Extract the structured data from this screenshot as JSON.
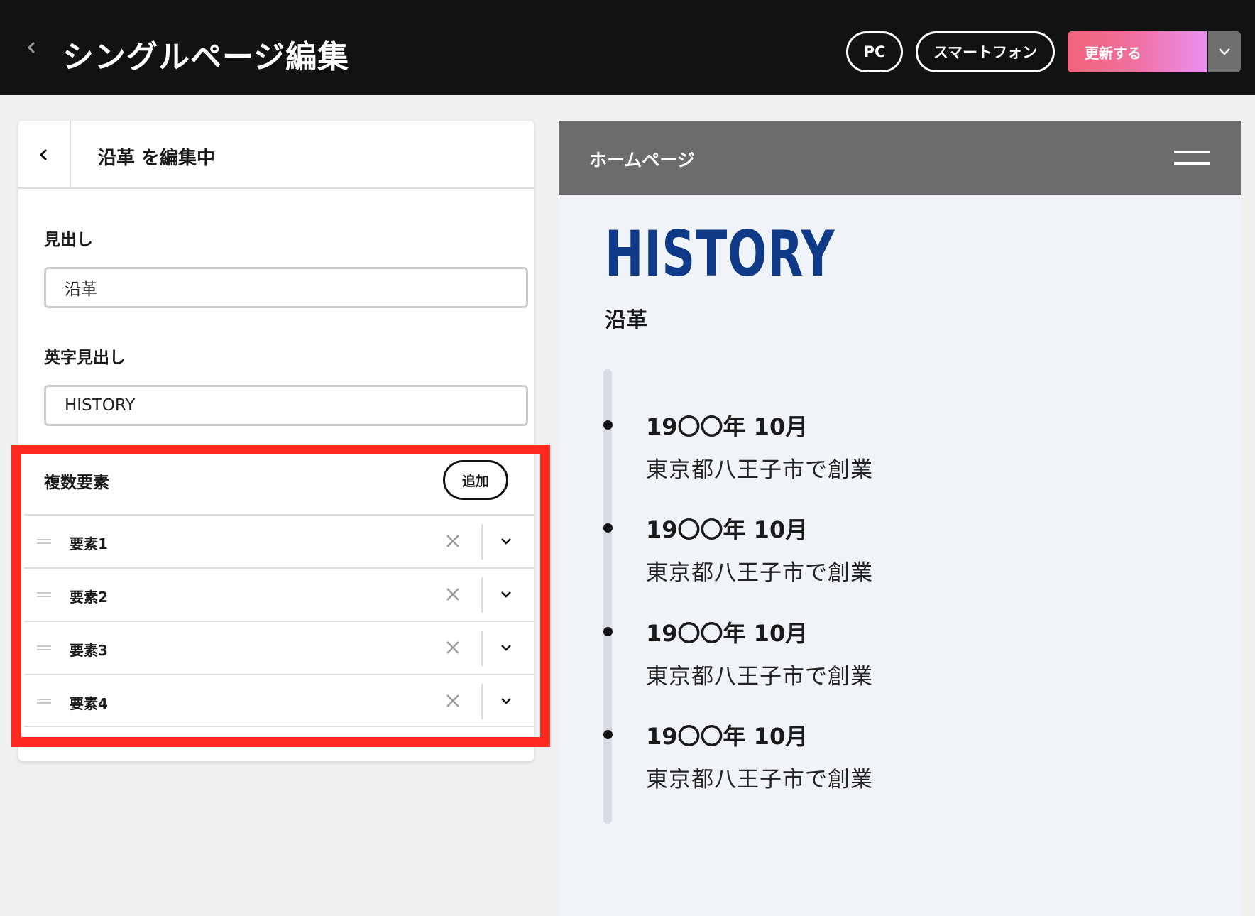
{
  "header": {
    "back_icon": "chevron-left-icon",
    "title": "シングルページ編集",
    "view_pc": "PC",
    "view_smartphone": "スマートフォン",
    "update_label": "更新する",
    "update_dropdown_icon": "chevron-down-icon",
    "update_gradient": [
      "#f2637b",
      "#e98ff0"
    ]
  },
  "panel": {
    "title": "沿革 を編集中",
    "heading_label": "見出し",
    "heading_value": "沿革",
    "en_heading_label": "英字見出し",
    "en_heading_value": "HISTORY",
    "multi_label": "複数要素",
    "add_label": "追加",
    "items": [
      {
        "label": "要素1"
      },
      {
        "label": "要素2"
      },
      {
        "label": "要素3"
      },
      {
        "label": "要素4"
      }
    ],
    "highlight_color": "#ff2a1f"
  },
  "preview": {
    "nav_title": "ホームページ",
    "menu_icon": "hamburger-menu-icon",
    "heading_en": "HISTORY",
    "heading_ja": "沿革",
    "accent_color": "#0e3a87",
    "timeline": [
      {
        "date": "19〇〇年 10月",
        "text": "東京都八王子市で創業"
      },
      {
        "date": "19〇〇年 10月",
        "text": "東京都八王子市で創業"
      },
      {
        "date": "19〇〇年 10月",
        "text": "東京都八王子市で創業"
      },
      {
        "date": "19〇〇年 10月",
        "text": "東京都八王子市で創業"
      }
    ]
  }
}
